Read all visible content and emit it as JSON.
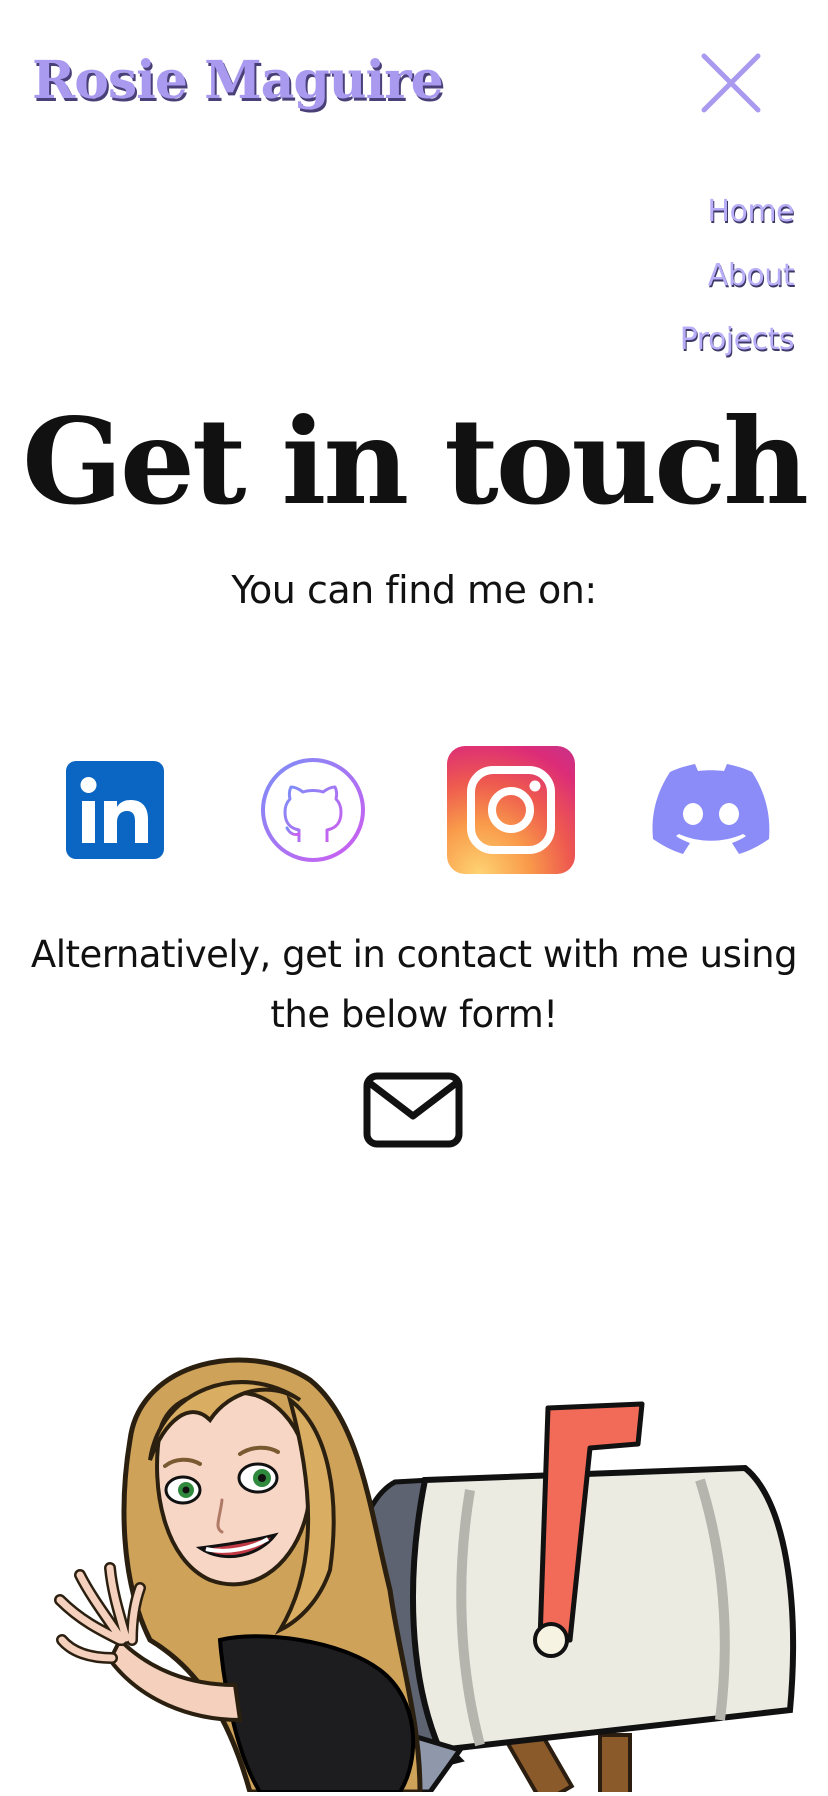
{
  "header": {
    "logo_text": "Rosie Maguire",
    "close_icon": "close-icon",
    "accent_color": "#a99af0"
  },
  "nav": {
    "items": [
      {
        "label": "Home"
      },
      {
        "label": "About"
      },
      {
        "label": "Projects"
      }
    ]
  },
  "main": {
    "title": "Get in touch",
    "subtitle": "You can find me on:",
    "socials": [
      {
        "name": "LinkedIn",
        "icon": "linkedin-icon",
        "color": "#0a66c2"
      },
      {
        "name": "GitHub",
        "icon": "github-icon",
        "color": "#b66cf0"
      },
      {
        "name": "Instagram",
        "icon": "instagram-icon",
        "color": "#f06542"
      },
      {
        "name": "Discord",
        "icon": "discord-icon",
        "color": "#8b8cf7"
      }
    ],
    "alt_text": "Alternatively, get in contact with me using the below form!",
    "mail_icon": "envelope-icon",
    "illustration": "bitmoji-mailbox-illustration"
  }
}
